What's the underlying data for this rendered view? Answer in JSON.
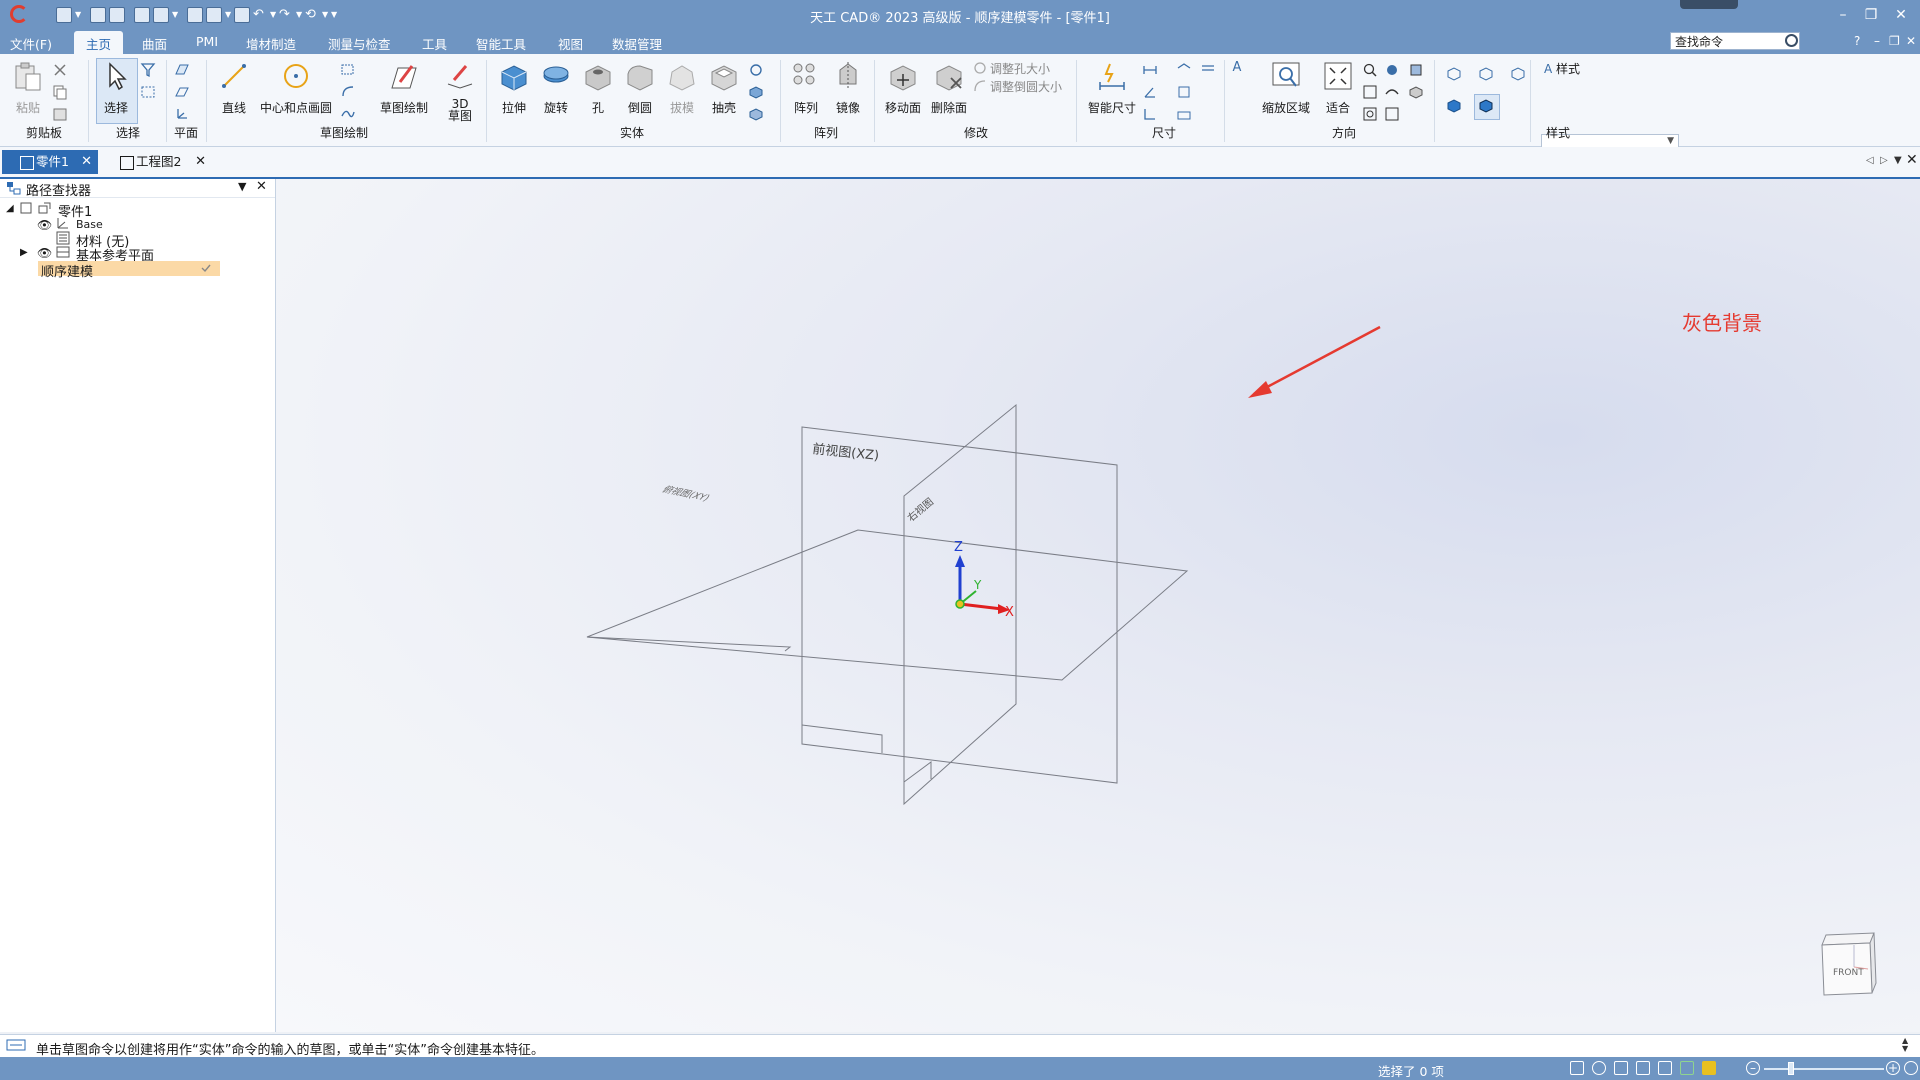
{
  "window": {
    "title": "天工 CAD® 2023 高级版 - 顺序建模零件 - [零件1]",
    "controls": [
      "–",
      "❐",
      "✕"
    ]
  },
  "menu": {
    "file": "文件(F)",
    "tabs": [
      "主页",
      "曲面",
      "PMI",
      "增材制造",
      "测量与检查",
      "工具",
      "智能工具",
      "视图",
      "数据管理"
    ],
    "search_value": "查找命令",
    "help": "?",
    "mini_controls": [
      "–",
      "❐",
      "✕"
    ]
  },
  "ribbon": {
    "clipboard": {
      "paste": "粘贴",
      "group": "剪贴板"
    },
    "select": {
      "select": "选择",
      "group": "选择"
    },
    "plane": {
      "group": "平面"
    },
    "sketch": {
      "line": "直线",
      "circle": "中心和点画圆",
      "sketch_draw": "草图绘制",
      "sketch3d_top": "3D",
      "sketch3d_bottom": "草图",
      "group": "草图绘制"
    },
    "solid": {
      "extrude": "拉伸",
      "revolve": "旋转",
      "hole": "孔",
      "round": "倒圆",
      "draft": "拔模",
      "shell": "抽壳",
      "group": "实体"
    },
    "pattern": {
      "pattern": "阵列",
      "mirror": "镜像",
      "group": "阵列"
    },
    "modify": {
      "move_face": "移动面",
      "delete_face": "删除面",
      "resize_hole": "调整孔大小",
      "resize_round": "调整倒圆大小",
      "group": "修改"
    },
    "dimension": {
      "smart": "智能尺寸",
      "group": "尺寸"
    },
    "orient": {
      "zoom_area": "缩放区域",
      "fit": "适合",
      "group": "方向"
    },
    "style": {
      "label": "样式",
      "group": "样式"
    }
  },
  "doc_tabs": [
    "零件1",
    "工程图2"
  ],
  "pathfinder": {
    "title": "路径查找器",
    "root": "零件1",
    "items": [
      "Base",
      "材料 (无)",
      "基本参考平面",
      "顺序建模"
    ]
  },
  "viewport": {
    "annotation": "灰色背景",
    "plane_front": "前视图(XZ)",
    "plane_right": "右视图",
    "plane_top": "俯视图(XY)",
    "axis_x": "X",
    "axis_y": "Y",
    "axis_z": "Z",
    "cube_face": "FRONT",
    "colors": {
      "annotation": "#e53a30",
      "x_axis": "#e02020",
      "y_axis": "#2fb32f",
      "z_axis": "#2040d0"
    }
  },
  "status": {
    "prompt": "单击草图命令以创建将用作“实体”命令的输入的草图，或单击“实体”命令创建基本特征。",
    "selection": "选择了 0 项"
  }
}
